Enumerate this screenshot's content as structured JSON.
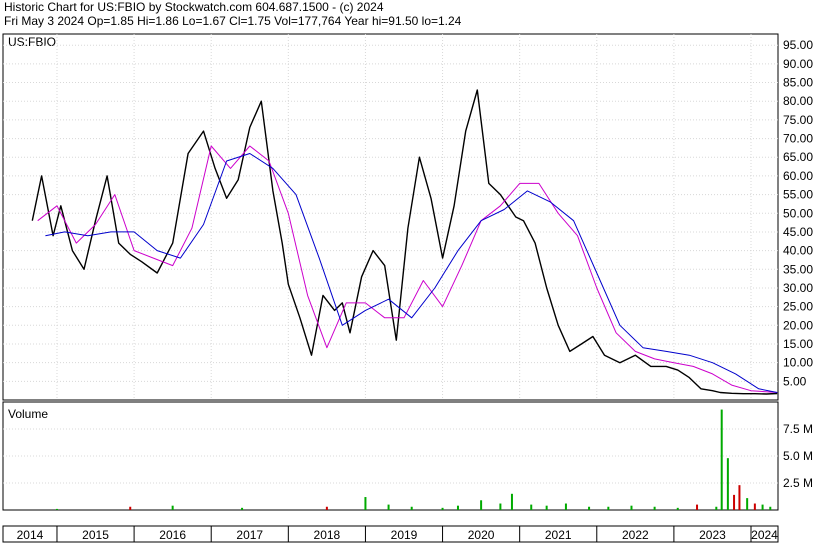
{
  "header": {
    "line1": "Historic Chart for US:FBIO by Stockwatch.com 604.687.1500 - (c) 2024",
    "line2": "Fri May  3 2024  Op=1.85  Hi=1.86  Lo=1.67  Cl=1.75  Vol=177,764  Year hi=91.50  lo=1.24"
  },
  "chart_data": [
    {
      "type": "line",
      "title": "US:FBIO",
      "ylim": [
        0,
        98
      ],
      "yticks": [
        "95.00",
        "90.00",
        "85.00",
        "80.00",
        "75.00",
        "70.00",
        "65.00",
        "60.00",
        "55.00",
        "50.00",
        "45.00",
        "40.00",
        "35.00",
        "30.00",
        "25.00",
        "20.00",
        "15.00",
        "10.00",
        "5.00"
      ],
      "x_start": 2014.3,
      "x_end": 2024.35,
      "x_tick_labels": [
        "2014",
        "2015",
        "2016",
        "2017",
        "2018",
        "2019",
        "2020",
        "2021",
        "2022",
        "2023",
        "2024"
      ],
      "grid": true,
      "series": [
        {
          "color": "#000000",
          "x": [
            2014.68,
            2014.8,
            2014.95,
            2015.05,
            2015.2,
            2015.35,
            2015.5,
            2015.65,
            2015.8,
            2015.95,
            2016.1,
            2016.3,
            2016.5,
            2016.7,
            2016.9,
            2017.05,
            2017.2,
            2017.35,
            2017.5,
            2017.65,
            2017.8,
            2017.92,
            2018.0,
            2018.15,
            2018.3,
            2018.45,
            2018.6,
            2018.7,
            2018.8,
            2018.95,
            2019.1,
            2019.25,
            2019.4,
            2019.55,
            2019.7,
            2019.85,
            2020.0,
            2020.15,
            2020.3,
            2020.45,
            2020.6,
            2020.75,
            2020.85,
            2020.95,
            2021.05,
            2021.2,
            2021.35,
            2021.5,
            2021.65,
            2021.8,
            2021.95,
            2022.1,
            2022.3,
            2022.5,
            2022.7,
            2022.9,
            2023.05,
            2023.2,
            2023.35,
            2023.5,
            2023.6,
            2023.75,
            2023.9,
            2024.05,
            2024.2,
            2024.34
          ],
          "y": [
            48,
            60,
            44,
            52,
            40,
            35,
            48,
            60,
            42,
            39,
            37,
            34,
            42,
            66,
            72,
            62,
            54,
            59,
            73,
            80,
            56,
            42,
            31,
            22,
            12,
            28,
            24,
            26,
            18,
            33,
            40,
            36,
            16,
            46,
            65,
            54,
            38,
            52,
            72,
            83,
            58,
            55,
            52,
            49,
            48,
            42,
            30,
            20,
            13,
            15,
            17,
            12,
            10,
            12,
            9,
            9,
            8,
            6,
            3,
            2.5,
            2,
            1.8,
            1.7,
            1.7,
            1.6,
            1.75
          ]
        },
        {
          "color": "#cc00cc",
          "x": [
            2014.75,
            2015.0,
            2015.25,
            2015.5,
            2015.75,
            2016.0,
            2016.25,
            2016.5,
            2016.75,
            2017.0,
            2017.25,
            2017.5,
            2017.75,
            2018.0,
            2018.25,
            2018.5,
            2018.75,
            2019.0,
            2019.25,
            2019.5,
            2019.75,
            2020.0,
            2020.25,
            2020.5,
            2020.75,
            2021.0,
            2021.25,
            2021.5,
            2021.75,
            2022.0,
            2022.25,
            2022.5,
            2022.75,
            2023.0,
            2023.25,
            2023.5,
            2023.75,
            2024.0,
            2024.34
          ],
          "y": [
            48,
            52,
            42,
            47,
            55,
            40,
            38,
            36,
            46,
            68,
            62,
            68,
            64,
            50,
            28,
            14,
            26,
            26,
            22,
            22,
            32,
            25,
            36,
            48,
            52,
            58,
            58,
            50,
            44,
            30,
            18,
            13,
            11,
            10,
            9,
            7,
            4,
            2.5,
            2
          ]
        },
        {
          "color": "#0000cc",
          "x": [
            2014.85,
            2015.1,
            2015.4,
            2015.7,
            2016.0,
            2016.3,
            2016.6,
            2016.9,
            2017.2,
            2017.5,
            2017.8,
            2018.1,
            2018.4,
            2018.7,
            2019.0,
            2019.3,
            2019.6,
            2019.9,
            2020.2,
            2020.5,
            2020.8,
            2021.1,
            2021.4,
            2021.7,
            2022.0,
            2022.3,
            2022.6,
            2022.9,
            2023.2,
            2023.5,
            2023.8,
            2024.1,
            2024.34
          ],
          "y": [
            44,
            45,
            44,
            45,
            45,
            40,
            38,
            47,
            64,
            66,
            62,
            55,
            38,
            20,
            24,
            27,
            22,
            30,
            40,
            48,
            51,
            56,
            53,
            48,
            34,
            20,
            14,
            13,
            12,
            10,
            7,
            3,
            2
          ]
        }
      ]
    },
    {
      "type": "bar",
      "title": "Volume",
      "ylim": [
        0,
        10
      ],
      "yticks": [
        "7.5 M",
        "5.0 M",
        "2.5 M"
      ],
      "yticks_values": [
        7.5,
        5.0,
        2.5
      ],
      "colors": {
        "up": "#00aa00",
        "down": "#cc0000"
      },
      "x": [
        2015.0,
        2015.95,
        2016.5,
        2017.4,
        2018.5,
        2019.0,
        2019.3,
        2019.6,
        2020.0,
        2020.2,
        2020.5,
        2020.75,
        2020.9,
        2021.15,
        2021.35,
        2021.6,
        2021.9,
        2022.15,
        2022.45,
        2022.75,
        2023.05,
        2023.3,
        2023.55,
        2023.62,
        2023.7,
        2023.78,
        2023.85,
        2023.95,
        2024.05,
        2024.15,
        2024.25
      ],
      "values": [
        0.1,
        0.3,
        0.4,
        0.2,
        0.3,
        1.2,
        0.5,
        0.3,
        0.2,
        0.4,
        0.9,
        0.6,
        1.5,
        0.5,
        0.4,
        0.6,
        0.3,
        0.3,
        0.4,
        0.3,
        0.2,
        0.5,
        0.3,
        9.3,
        4.8,
        1.4,
        2.3,
        1.1,
        0.6,
        0.5,
        0.3
      ],
      "up": [
        true,
        false,
        true,
        true,
        false,
        true,
        true,
        true,
        true,
        true,
        true,
        true,
        true,
        true,
        true,
        true,
        true,
        true,
        true,
        true,
        true,
        false,
        true,
        true,
        true,
        false,
        false,
        true,
        false,
        true,
        true
      ]
    }
  ]
}
